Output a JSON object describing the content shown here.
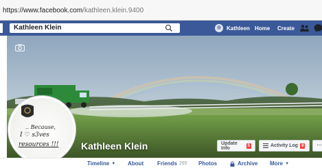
{
  "browser": {
    "url_host": "https://www.facebook.com",
    "url_path": "/kathleen.klein.9400"
  },
  "nav": {
    "search_value": "Kathleen Klein",
    "profile_label": "Kathleen",
    "home_label": "Home",
    "create_label": "Create",
    "icons": [
      "search-icon",
      "friends-requests-icon",
      "messenger-icon"
    ],
    "color": "#3b5998"
  },
  "cover": {
    "name": "Kathleen Klein",
    "update_info_label": "Update Info",
    "update_info_badge": "5",
    "activity_log_label": "Activity Log",
    "activity_log_badge": "9",
    "more_label": "···",
    "camera_icon": "camera-icon"
  },
  "profile_picture": {
    "logo_alt": "brand-seal",
    "lines": [
      ".. Because,",
      "I ♡ s3ves",
      "resources !!!"
    ]
  },
  "tabs": [
    {
      "label": "Timeline",
      "caret": "▼"
    },
    {
      "label": "About"
    },
    {
      "label": "Friends",
      "count": "265"
    },
    {
      "label": "Photos"
    },
    {
      "label": "Archive"
    },
    {
      "label": "More",
      "caret": "▼"
    }
  ]
}
